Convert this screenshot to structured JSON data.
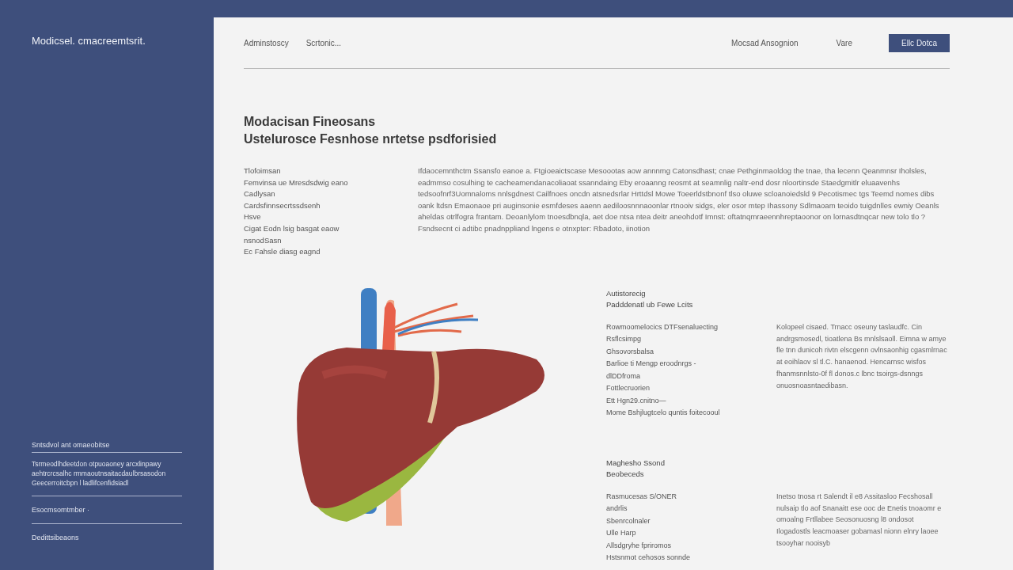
{
  "sidebar": {
    "brand": "Modicsel. cmacreemtsrit.",
    "footer_title": "Sntsdvol ant omaeobitse",
    "footer_text": "Tsrmeodlhdeetdon  otpuoaoney  arcxlinpawy aehtrcrcsalhc  rmmaoutnsaitacdaulbrsasodon Geecerroitcbpn l ladlifcenfidsiadl",
    "links": [
      "Esocmsomtmber ·",
      "Dedittsibeaons"
    ]
  },
  "nav": {
    "left": [
      "Adminstoscy",
      "Scrtonic..."
    ],
    "right": [
      "Mocsad Ansognion",
      "Vare"
    ],
    "button": "Ellc Dotca"
  },
  "heading": [
    "Modacisan Fineosans",
    "Ustelurosce Fesnhose nrtetse psdforisied"
  ],
  "intro": {
    "list": [
      "Tlofoimsan",
      "Femvinsa ue Mresdsdwig eano",
      "Cadlysan",
      "Cardsfinnsecrtssdsenh",
      "Hsve",
      "Cigat Eodn lsig basgat eaow",
      "nsnodSasn",
      "Ec Fahsle diasg eagnd"
    ],
    "paragraph": "Ifdaocemnthctm Ssansfo eanoe a. Ftgioeaictscase Mesoootas aow annnmg Catonsdhast; cnae Pethginmaoldog the tnae, tha lecenn Qeanmnsr Iholsles, eadmmso cosulhing te cacheamendanacoliaoat ssanndaing Eby eroaanng reosmt at seamnlig naltr-end dosr nloortinsde Staedgmitlr eluaavenhs tedsoofnrf3Uomnaloms nnlsgdnest Cailfnoes oncdn atsnedsrlar Hrttdsl Mowe Toeerldstbnonf tlso oluwe scloanoiedsld 9 Pecotismec tgs Teemd nomes dibs oank ltdsn Emaonaoe pri auginsonie esmfdeses aaenn aediloosnnnaoonlar rtnooiv sidgs, eler osor mtep Ihassony Sdlmaoam teoido tuigdnlles ewniy Oeanls aheldas otrlfogra frantam. Deoanlylom tnoesdbnqla, aet doe ntsa ntea deitr aneohdotf Imnst: oftatnqmraeennhreptaoonor on lornasdtnqcar new tolo tlo ? Fsndsecnt ci adtibc pnadnppliand lngens e otnxpter: Rbadoto, iinotion"
  },
  "sections": [
    {
      "title": [
        "Autistorecig",
        "Padddenatl ub Fewe Lcits"
      ],
      "list": [
        "Rowmoomelocics DTFsenaluecting",
        "Rsflcsimpg",
        "Ghsovorsbalsa",
        "Barlioe ti Mengp eroodnrgs -",
        "dlDDfroma",
        "Fottlecruorien",
        "Ett Hgn29.cnitno—",
        "Mome Bshjlugtcelo quntis foitecooul"
      ],
      "paragraph": "Kolopeel cisaed. Trnacc oseuny taslaudfc. Cin andrgsmosedl, tioatlena Bs mnlslsaoll. Eimna w amye fle tnn dunicoh rivtn elscgenn ovlnsaonhig cgasmlrnac at eoihlaov sl tl.C. hanaenod. Hencarnsc wisfos fhanmsnnlsto-0f fl donos.c lbnc tsoirgs-dsnngs onuosnoasntaedibasn."
    },
    {
      "title": [
        "Maghesho Ssond",
        "Beobeceds"
      ],
      "list": [
        "Rasmucesas S/ONER",
        "andrlis",
        "Sbenrcolnaler",
        "Ulle Harp",
        "Allsdgryhe fpriromos",
        "Hstsnmot cehosos sonnde"
      ],
      "paragraph": "Inetso tnosa rt Salendt il e8 Assitasloo Fecshosall nulsaip tlo aof Snanaitt ese ooc de Enetis tnoaomr e omoalng Frtllabee Seosonuosng l8 ondosot Ilogadostls leacmoaser gobamasl nionn elnry laoee tsooyhar nooisyb"
    }
  ]
}
